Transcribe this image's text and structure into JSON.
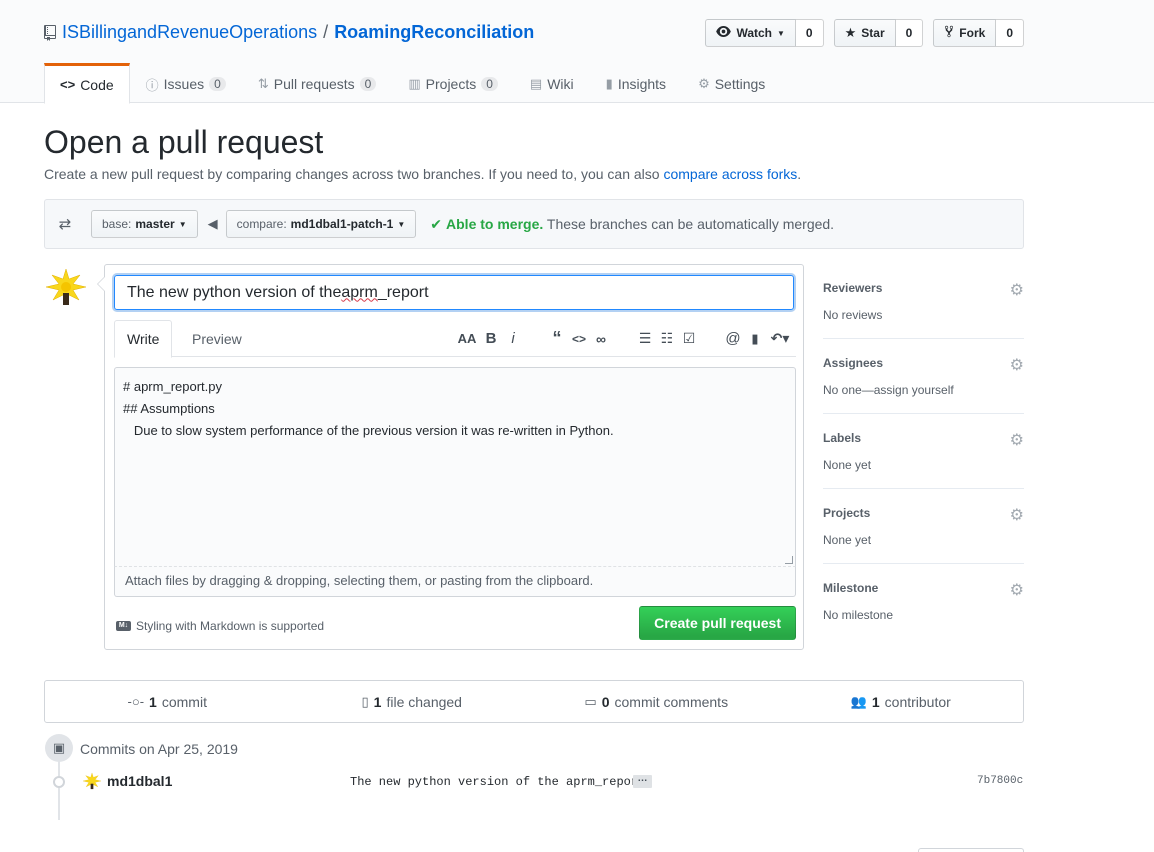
{
  "repo": {
    "owner": "ISBillingandRevenueOperations",
    "separator": "/",
    "name": "RoamingReconciliation"
  },
  "actions": {
    "watch_label": "Watch",
    "watch_count": "0",
    "star_label": "Star",
    "star_count": "0",
    "fork_label": "Fork",
    "fork_count": "0"
  },
  "nav": {
    "code": "Code",
    "issues": "Issues",
    "issues_count": "0",
    "pulls": "Pull requests",
    "pulls_count": "0",
    "projects": "Projects",
    "projects_count": "0",
    "wiki": "Wiki",
    "insights": "Insights",
    "settings": "Settings"
  },
  "page": {
    "title": "Open a pull request",
    "description": "Create a new pull request by comparing changes across two branches. If you need to, you can also ",
    "description_link": "compare across forks",
    "description_end": "."
  },
  "range": {
    "base_prefix": "base:",
    "base_branch": "master",
    "compare_prefix": "compare:",
    "compare_branch": "md1dbal1-patch-1",
    "merge_status": "Able to merge.",
    "merge_detail": "These branches can be automatically merged."
  },
  "form": {
    "title_value_before": "The new python version of the ",
    "title_value_underlined": "aprm",
    "title_value_after": "_report",
    "tab_write": "Write",
    "tab_preview": "Preview",
    "body_lines": [
      "# aprm_report.py",
      "## Assumptions",
      "   Due to slow system performance of the previous version it was re-written in Python."
    ],
    "drag_drop": "Attach files by dragging & dropping, selecting them, or pasting from the clipboard.",
    "markdown_note": "Styling with Markdown is supported",
    "submit": "Create pull request"
  },
  "sidebar": {
    "reviewers": "Reviewers",
    "reviewers_value": "No reviews",
    "assignees": "Assignees",
    "assignees_value": "No one—assign yourself",
    "labels": "Labels",
    "labels_value": "None yet",
    "projects": "Projects",
    "projects_value": "None yet",
    "milestone": "Milestone",
    "milestone_value": "No milestone"
  },
  "summary": {
    "commits_count": "1",
    "commits_label": "commit",
    "files_count": "1",
    "files_label": "file changed",
    "comments_count": "0",
    "comments_label": "commit comments",
    "contributors_count": "1",
    "contributors_label": "contributor"
  },
  "commits": {
    "group_title": "Commits on Apr 25, 2019",
    "author": "md1dbal1",
    "message": "The new python version of the aprm_report",
    "ellipsis": "…",
    "sha": "7b7800c"
  },
  "colors": {
    "link": "#0366d6",
    "success": "#28a745",
    "tab_accent": "#e36209"
  }
}
